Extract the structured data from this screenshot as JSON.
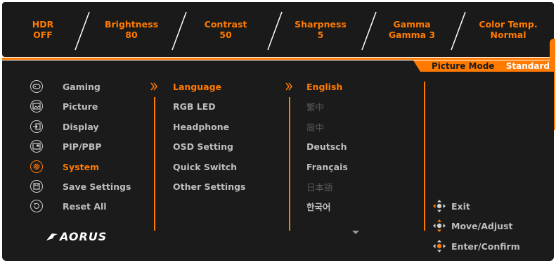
{
  "top_bar": [
    {
      "label": "HDR",
      "value": "OFF"
    },
    {
      "label": "Brightness",
      "value": "80"
    },
    {
      "label": "Contrast",
      "value": "50"
    },
    {
      "label": "Sharpness",
      "value": "5"
    },
    {
      "label": "Gamma",
      "value": "Gamma 3"
    },
    {
      "label": "Color Temp.",
      "value": "Normal"
    }
  ],
  "picture_mode": {
    "label": "Picture Mode",
    "value": "Standard"
  },
  "main_menu": [
    {
      "label": "Gaming",
      "icon": "gamepad-icon"
    },
    {
      "label": "Picture",
      "icon": "picture-icon"
    },
    {
      "label": "Display",
      "icon": "display-input-icon"
    },
    {
      "label": "PIP/PBP",
      "icon": "pip-icon"
    },
    {
      "label": "System",
      "icon": "gear-icon",
      "active": true
    },
    {
      "label": "Save Settings",
      "icon": "save-icon"
    },
    {
      "label": "Reset All",
      "icon": "reset-icon"
    }
  ],
  "submenu": [
    {
      "label": "Language",
      "active": true
    },
    {
      "label": "RGB LED"
    },
    {
      "label": "Headphone"
    },
    {
      "label": "OSD Setting"
    },
    {
      "label": "Quick Switch"
    },
    {
      "label": "Other Settings"
    }
  ],
  "languages": [
    {
      "label": "English",
      "active": true
    },
    {
      "label": "繁中",
      "dim": true
    },
    {
      "label": "简中",
      "dim": true
    },
    {
      "label": "Deutsch"
    },
    {
      "label": "Français"
    },
    {
      "label": "日本語",
      "dim": true
    },
    {
      "label": "한국어"
    }
  ],
  "brand": {
    "logo_text": "AORUS"
  },
  "hints": [
    {
      "label": "Exit",
      "icon": "dpad-left-icon"
    },
    {
      "label": "Move/Adjust",
      "icon": "dpad-updown-icon"
    },
    {
      "label": "Enter/Confirm",
      "icon": "dpad-press-icon"
    }
  ],
  "colors": {
    "accent": "#ff7a00",
    "background": "#1b1b1b",
    "text": "#bdbdbd",
    "dim_text": "#5a5a5a"
  }
}
